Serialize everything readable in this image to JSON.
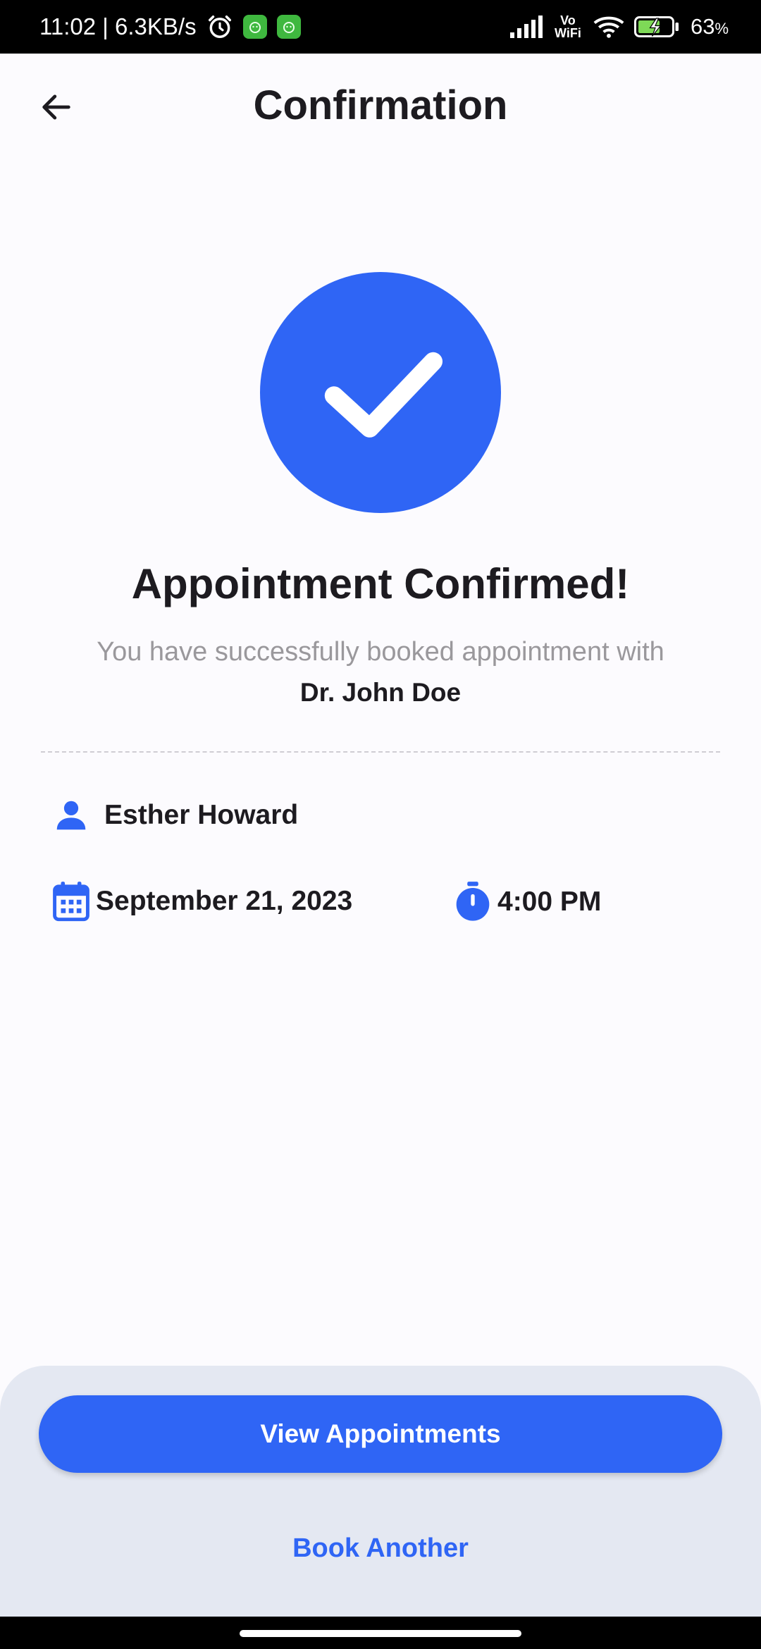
{
  "status_bar": {
    "time_speed": "11:02 | 6.3KB/s",
    "network_label": "Vo WiFi",
    "battery": "63",
    "battery_unit": "%"
  },
  "app_bar": {
    "title": "Confirmation"
  },
  "confirmation": {
    "headline": "Appointment Confirmed!",
    "subtext": "You have successfully booked appointment with",
    "doctor": "Dr. John Doe"
  },
  "details": {
    "patient_name": "Esther Howard",
    "date": "September 21, 2023",
    "time": "4:00 PM"
  },
  "actions": {
    "primary_label": "View Appointments",
    "secondary_label": "Book Another"
  },
  "colors": {
    "accent": "#2f65f5",
    "panel": "#e4e8f2",
    "background": "#fcfbfe"
  },
  "icons": {
    "back": "arrow-left-icon",
    "success": "check-circle-icon",
    "patient": "person-icon",
    "date": "calendar-icon",
    "time": "stopwatch-icon"
  }
}
